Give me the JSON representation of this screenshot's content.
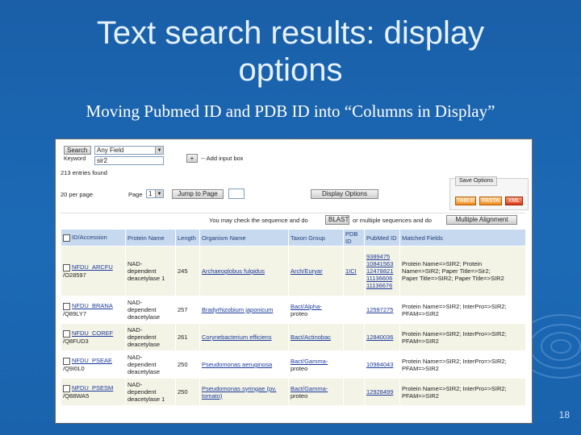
{
  "slide": {
    "title_line1": "Text search results: display",
    "title_line2": "options",
    "subtitle": "Moving Pubmed ID and PDB ID into “Columns in Display”",
    "slide_number": "18"
  },
  "screenshot": {
    "search": {
      "label": "Search",
      "field_select": "Any Field",
      "keyword_label": "Keyword",
      "keyword_value": "sir2",
      "add_label": "+",
      "add_text": "-- Add input box"
    },
    "entries_found": "213 entries found",
    "per_page_label": "20 per page",
    "page_label": "Page",
    "page_value": "1",
    "jump_button": "Jump to Page",
    "display_options_button": "Display Options",
    "save_options": {
      "title": "Save Options",
      "buttons": [
        "TABLE",
        "FASTA",
        "XML"
      ]
    },
    "blast_text_before": "You may check the sequence and do",
    "blast_button": "BLAST",
    "blast_text_after": "or multiple sequences and do",
    "align_button": "Multiple Alignment",
    "columns": [
      "ID/Accession",
      "Protein Name",
      "Length",
      "Organism Name",
      "Taxon Group",
      "PDB ID",
      "PubMed ID",
      "Matched Fields"
    ],
    "rows": [
      {
        "id": "NFDU_ARCFU",
        "acc": "/O28597",
        "protein": [
          "NAD-",
          "dependent",
          "deacetylase 1"
        ],
        "length": "245",
        "organism": "Archaeoglobus fulgidus",
        "taxon": "Arch/Euryar",
        "pdb": "1ICI",
        "pubmed": [
          "9389475",
          "10841563",
          "12478821",
          "11136606",
          "11136676"
        ],
        "matched": [
          "Protein Name=>SIR2; Protein",
          "Name=>SIR2; Paper Title=>Sir2;",
          "Paper Title=>SIR2; Paper Title=>SIR2"
        ]
      },
      {
        "id": "NFDU_BRANA",
        "acc": "/Q89LY7",
        "protein": [
          "NAD-",
          "dependent",
          "deacetylase"
        ],
        "length": "257",
        "organism": "Bradyrhizobium japonicum",
        "taxon": "Bact/Alpha-",
        "taxon2": "proteo",
        "pdb": "",
        "pubmed": [
          "12597275"
        ],
        "matched": [
          "Protein Name=>SIR2; InterPro=>SIR2;",
          "PFAM=>SIR2"
        ]
      },
      {
        "id": "NFDU_COREF",
        "acc": "/Q8FUD3",
        "protein": [
          "NAD-",
          "dependent",
          "deacetylase"
        ],
        "length": "261",
        "organism": "Corynebacterium efficiens",
        "taxon": "Bact/Actinobac",
        "pdb": "",
        "pubmed": [
          "12840036"
        ],
        "matched": [
          "Protein Name=>SIR2; InterPro=>SIR2;",
          "PFAM=>SIR2"
        ]
      },
      {
        "id": "NFDU_PSEAE",
        "acc": "/Q9I0L0",
        "protein": [
          "NAD-",
          "dependent",
          "deacetylase"
        ],
        "length": "250",
        "organism": "Pseudomonas aeruginosa",
        "taxon": "Bact/Gamma-",
        "taxon2": "proteo",
        "pdb": "",
        "pubmed": [
          "10984043"
        ],
        "matched": [
          "Protein Name=>SIR2; InterPro=>SIR2;",
          "PFAM=>SIR2"
        ]
      },
      {
        "id": "NFDU_PSESM",
        "acc": "/Q88WA5",
        "protein": [
          "NAD-",
          "dependent",
          "deacetylase 1"
        ],
        "length": "250",
        "organism": "Pseudomonas syringae (pv. tomato)",
        "taxon": "Bact/Gamma-",
        "taxon2": "proteo",
        "pdb": "",
        "pubmed": [
          "12928499"
        ],
        "matched": [
          "Protein Name=>SIR2; InterPro=>SIR2;",
          "PFAM=>SIR2"
        ]
      }
    ]
  }
}
